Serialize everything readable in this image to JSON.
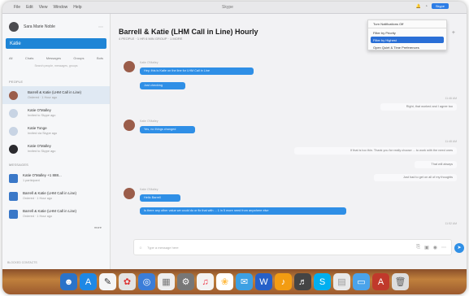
{
  "menubar": {
    "items": [
      "File",
      "Edit",
      "View",
      "Window",
      "Help"
    ],
    "window_title": "Skype",
    "right_label": "Skype"
  },
  "sidebar": {
    "user_name": "Sara Marie Noble",
    "search_label": "Katie",
    "tabs": [
      "All",
      "Chats",
      "Messages",
      "Groups",
      "Bots"
    ],
    "hint": "Search people, messages, groups",
    "people_header": "PEOPLE",
    "people": [
      {
        "name": "Barrell & Katie (LHM Call in Line)",
        "sub": "Ordered · 1 Hour ago"
      },
      {
        "name": "Katie O'Malley",
        "sub": "Invited to Skype ago"
      },
      {
        "name": "Katie Tonge",
        "sub": "Invited via Skype ago"
      },
      {
        "name": "Katie O'Malley",
        "sub": "Invited to Skype ago"
      }
    ],
    "messages_header": "MESSAGES",
    "messages": [
      {
        "name": "Katie O'Malley +1 888...",
        "sub": "1 participant"
      },
      {
        "name": "Barrell & Katie (LHM Call in Line)",
        "sub": "Ordered · 1 Hour ago"
      },
      {
        "name": "Barrell & Katie (LHM Call in Line)",
        "sub": "Ordered · 1 Hour ago"
      }
    ],
    "more_label": "more",
    "bottom_label": "BLOCKED CONTACTS"
  },
  "chat": {
    "title": "Barrell & Katie (LHM Call in Line) Hourly",
    "subtitle": "4 PEOPLE · 1 HR 6 MIN GROUP · 1 MORE",
    "composer_placeholder": "Type a message here"
  },
  "dropdown": {
    "items": [
      "Turn Notifications Off",
      "Filter by Priority",
      "Filter by Highest",
      "Open Quiet & Time Preferences"
    ],
    "selected_index": 2
  },
  "messages": [
    {
      "side": "left",
      "name": "Katie O'Malley",
      "text": "Hey, this is Katie on the line for LHM Call in Line"
    },
    {
      "side": "left",
      "text": "Just checking"
    },
    {
      "side": "right",
      "text": "Right, that worked and I agree too",
      "time": "11:46 AM"
    },
    {
      "side": "left",
      "name": "Katie O'Malley",
      "text": "Yes, no things changed"
    },
    {
      "side": "right",
      "text": "If that is too thin. Thank you for really choose ... to work with the need ones",
      "time": "11:48 AM"
    },
    {
      "side": "right",
      "text": "That will always"
    },
    {
      "side": "right",
      "text": "Just had to get on all of my thoughts"
    },
    {
      "side": "left",
      "name": "Katie O'Malley",
      "text": "Hello Barrell"
    },
    {
      "side": "left",
      "text": "Is there any other value we could do or fix that with ... 1 in 5 more need from anywhere else"
    },
    {
      "side": "right",
      "text": "",
      "time": "11:52 AM"
    }
  ],
  "colors": {
    "accent": "#2f8fe6",
    "dock": "#b4743a"
  }
}
